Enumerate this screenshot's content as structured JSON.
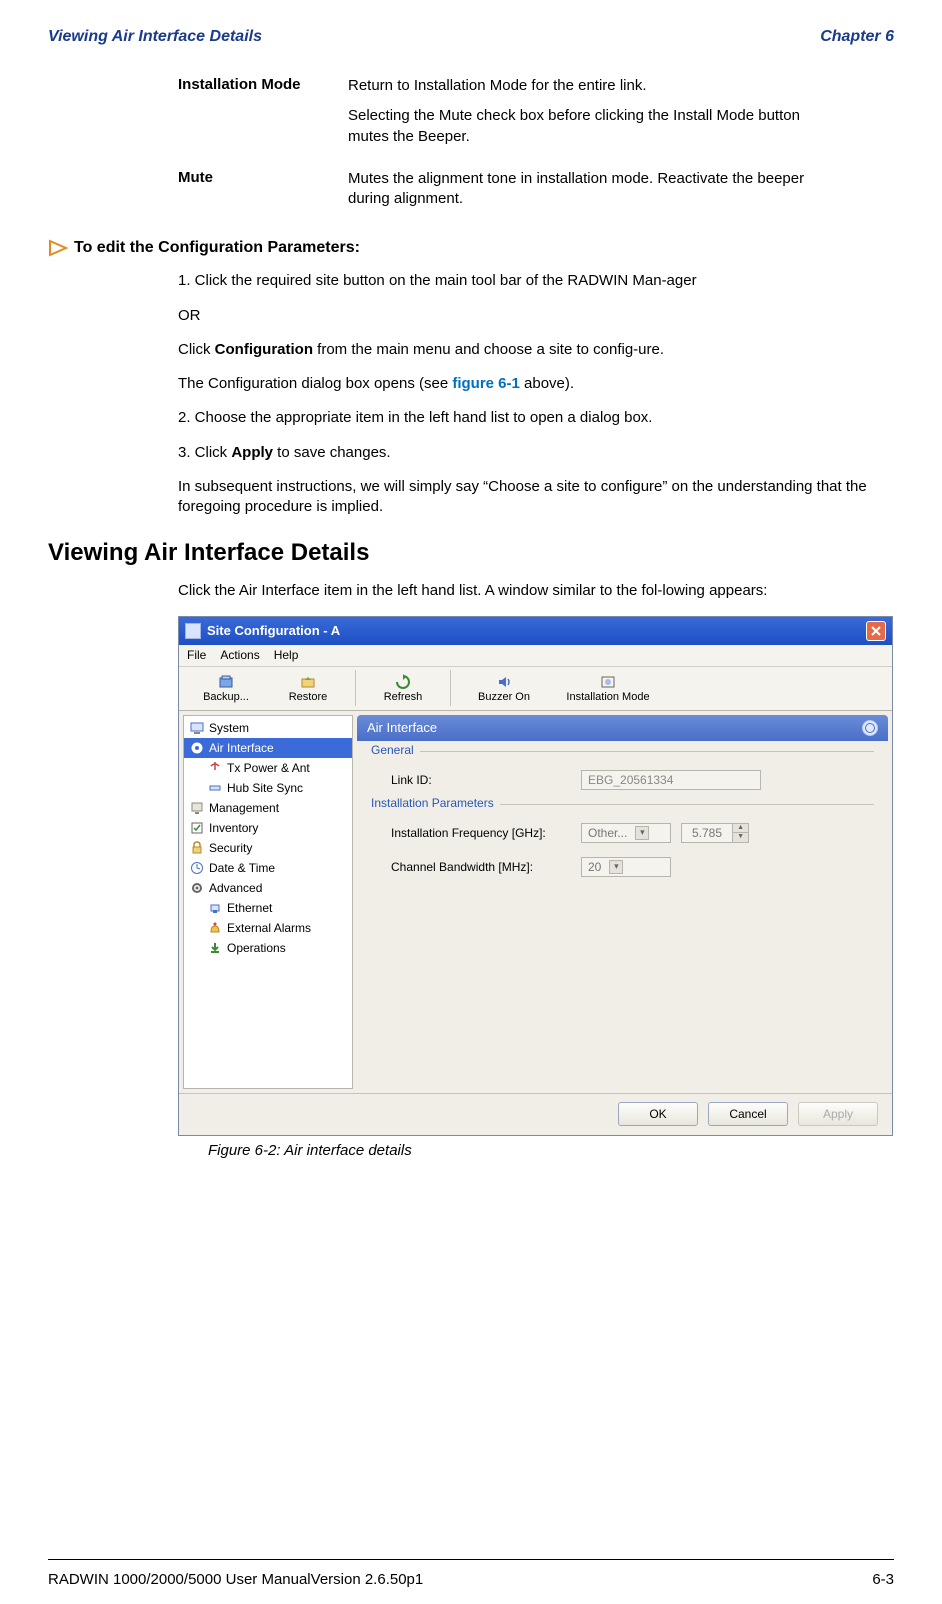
{
  "header": {
    "left": "Viewing Air Interface Details",
    "right": "Chapter 6"
  },
  "defs": [
    {
      "term": "Installation Mode",
      "paras": [
        "Return to Installation Mode for the entire link.",
        "Selecting the Mute check box before clicking the Install Mode button mutes the Beeper."
      ]
    },
    {
      "term": "Mute",
      "paras": [
        "Mutes the alignment tone in installation mode. Reactivate the beeper during alignment."
      ]
    }
  ],
  "arrow_heading": "To edit the Configuration Parameters:",
  "steps": {
    "s1a": "1. Click the required site button on the main tool bar of the RADWIN Man-ager",
    "or": "OR",
    "s1b_pre": "Click ",
    "s1b_bold": "Configuration",
    "s1b_post": " from the main menu and choose a site to config-ure.",
    "s1c_pre": "The Configuration dialog box opens (see ",
    "s1c_link": "figure 6-1",
    "s1c_post": " above).",
    "s2": "2. Choose the appropriate item in the left hand list to open a dialog box.",
    "s3_pre": "3. Click ",
    "s3_bold": "Apply",
    "s3_post": " to save changes.",
    "closing": "In subsequent instructions, we will simply say “Choose a site to configure” on the understanding that the foregoing procedure is implied."
  },
  "section_title": "Viewing Air Interface Details",
  "section_intro": "Click the Air Interface item in the left hand list. A window similar to the fol-lowing appears:",
  "dialog": {
    "title": "Site Configuration - A",
    "menus": [
      "File",
      "Actions",
      "Help"
    ],
    "toolbar": [
      "Backup...",
      "Restore",
      "Refresh",
      "Buzzer On",
      "Installation Mode"
    ],
    "sidebar": [
      {
        "label": "System",
        "indent": false
      },
      {
        "label": "Air Interface",
        "indent": false,
        "selected": true
      },
      {
        "label": "Tx Power & Ant",
        "indent": true
      },
      {
        "label": "Hub Site Sync",
        "indent": true
      },
      {
        "label": "Management",
        "indent": false
      },
      {
        "label": "Inventory",
        "indent": false
      },
      {
        "label": "Security",
        "indent": false
      },
      {
        "label": "Date & Time",
        "indent": false
      },
      {
        "label": "Advanced",
        "indent": false
      },
      {
        "label": "Ethernet",
        "indent": true
      },
      {
        "label": "External Alarms",
        "indent": true
      },
      {
        "label": "Operations",
        "indent": true
      }
    ],
    "panel_title": "Air Interface",
    "group_general": "General",
    "link_id_label": "Link ID:",
    "link_id_value": "EBG_20561334",
    "group_install": "Installation Parameters",
    "freq_label": "Installation Frequency [GHz]:",
    "freq_dd": "Other...",
    "freq_spin": "5.785",
    "bw_label": "Channel Bandwidth [MHz]:",
    "bw_value": "20",
    "buttons": {
      "ok": "OK",
      "cancel": "Cancel",
      "apply": "Apply"
    }
  },
  "fig_caption": "Figure 6-2: Air interface details",
  "footer": {
    "left": "RADWIN 1000/2000/5000 User ManualVersion  2.6.50p1",
    "right": "6-3"
  }
}
